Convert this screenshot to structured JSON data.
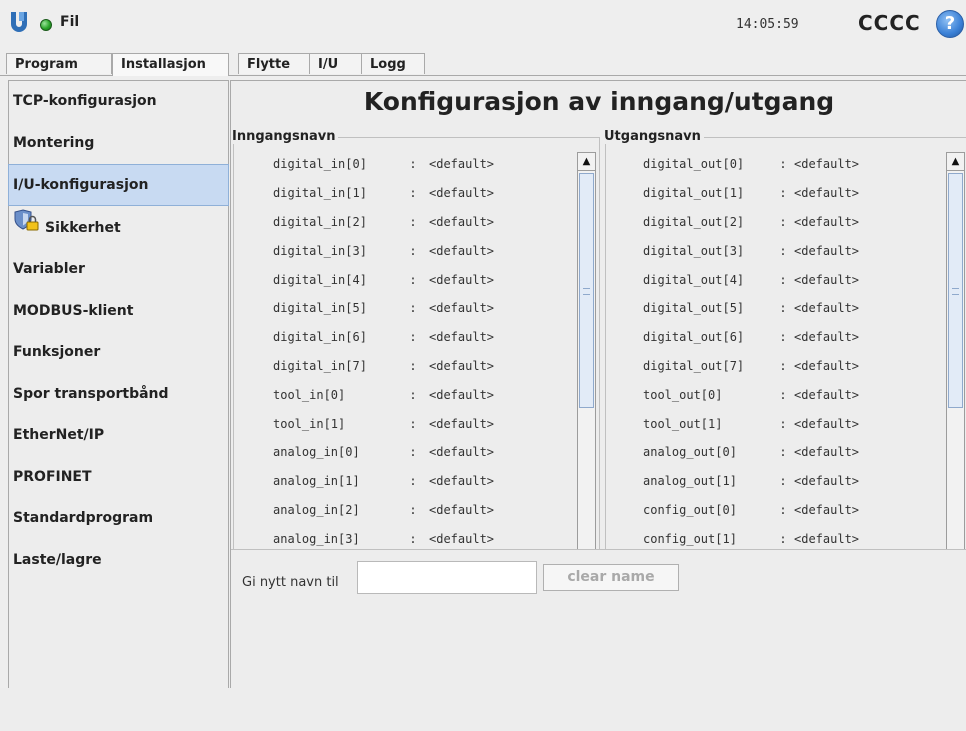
{
  "header": {
    "file_label": "Fil",
    "clock": "14:05:59",
    "robot_name": "CCCC",
    "help_symbol": "?",
    "logo_icon": "ur-logo-icon",
    "status_color": "#2aa52a"
  },
  "tabs": [
    {
      "label": "Program"
    },
    {
      "label": "Installasjon"
    },
    {
      "label": "Flytte"
    },
    {
      "label": "I/U"
    },
    {
      "label": "Logg"
    }
  ],
  "sidebar": {
    "items": [
      {
        "label": "TCP-konfigurasjon"
      },
      {
        "label": "Montering"
      },
      {
        "label": "I/U-konfigurasjon",
        "selected": true
      },
      {
        "label": "Sikkerhet",
        "icon": "shield-lock-icon"
      },
      {
        "label": "Variabler"
      },
      {
        "label": "MODBUS-klient"
      },
      {
        "label": "Funksjoner"
      },
      {
        "label": "Spor transportbånd"
      },
      {
        "label": "EtherNet/IP"
      },
      {
        "label": "PROFINET"
      },
      {
        "label": "Standardprogram"
      },
      {
        "label": "Laste/lagre"
      }
    ]
  },
  "main": {
    "title": "Konfigurasjon av inngang/utgang",
    "inputs": {
      "title": "Inngangsnavn",
      "rows": [
        {
          "name": "digital_in[0]",
          "value": "<default>"
        },
        {
          "name": "digital_in[1]",
          "value": "<default>"
        },
        {
          "name": "digital_in[2]",
          "value": "<default>"
        },
        {
          "name": "digital_in[3]",
          "value": "<default>"
        },
        {
          "name": "digital_in[4]",
          "value": "<default>"
        },
        {
          "name": "digital_in[5]",
          "value": "<default>"
        },
        {
          "name": "digital_in[6]",
          "value": "<default>"
        },
        {
          "name": "digital_in[7]",
          "value": "<default>"
        },
        {
          "name": "tool_in[0]",
          "value": "<default>"
        },
        {
          "name": "tool_in[1]",
          "value": "<default>"
        },
        {
          "name": "analog_in[0]",
          "value": "<default>"
        },
        {
          "name": "analog_in[1]",
          "value": "<default>"
        },
        {
          "name": "analog_in[2]",
          "value": "<default>"
        },
        {
          "name": "analog_in[3]",
          "value": "<default>"
        }
      ]
    },
    "outputs": {
      "title": "Utgangsnavn",
      "rows": [
        {
          "name": "digital_out[0]",
          "value": "<default>"
        },
        {
          "name": "digital_out[1]",
          "value": "<default>"
        },
        {
          "name": "digital_out[2]",
          "value": "<default>"
        },
        {
          "name": "digital_out[3]",
          "value": "<default>"
        },
        {
          "name": "digital_out[4]",
          "value": "<default>"
        },
        {
          "name": "digital_out[5]",
          "value": "<default>"
        },
        {
          "name": "digital_out[6]",
          "value": "<default>"
        },
        {
          "name": "digital_out[7]",
          "value": "<default>"
        },
        {
          "name": "tool_out[0]",
          "value": "<default>"
        },
        {
          "name": "tool_out[1]",
          "value": "<default>"
        },
        {
          "name": "analog_out[0]",
          "value": "<default>"
        },
        {
          "name": "analog_out[1]",
          "value": "<default>"
        },
        {
          "name": "config_out[0]",
          "value": "<default>"
        },
        {
          "name": "config_out[1]",
          "value": "<default>"
        }
      ]
    },
    "rename": {
      "label": "Gi nytt navn til",
      "value": "",
      "clear_label": "clear name"
    }
  }
}
